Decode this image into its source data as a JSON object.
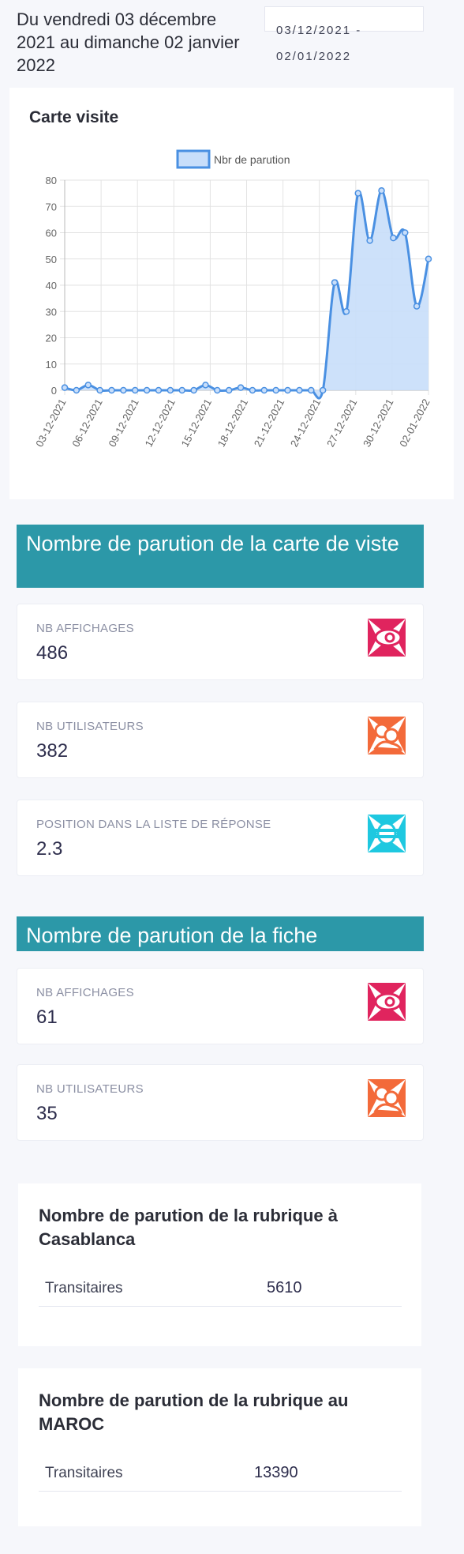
{
  "header": {
    "period_text": "Du vendredi 03 décembre 2021 au dimanche 02 janvier 2022",
    "date_range": "03/12/2021 - 02/01/2022"
  },
  "chart_card": {
    "title": "Carte visite"
  },
  "chart_data": {
    "type": "area",
    "legend_position": "top",
    "grid": true,
    "ylim": [
      0,
      80
    ],
    "y_ticks": [
      0,
      10,
      20,
      30,
      40,
      50,
      60,
      70,
      80
    ],
    "x_tick_labels": [
      "03-12-2021",
      "06-12-2021",
      "09-12-2021",
      "12-12-2021",
      "15-12-2021",
      "18-12-2021",
      "21-12-2021",
      "24-12-2021",
      "27-12-2021",
      "30-12-2021",
      "02-01-2022"
    ],
    "x": [
      "03-12-2021",
      "04-12-2021",
      "05-12-2021",
      "06-12-2021",
      "07-12-2021",
      "08-12-2021",
      "09-12-2021",
      "10-12-2021",
      "11-12-2021",
      "12-12-2021",
      "13-12-2021",
      "14-12-2021",
      "15-12-2021",
      "16-12-2021",
      "17-12-2021",
      "18-12-2021",
      "19-12-2021",
      "20-12-2021",
      "21-12-2021",
      "22-12-2021",
      "23-12-2021",
      "24-12-2021",
      "25-12-2021",
      "26-12-2021",
      "27-12-2021",
      "28-12-2021",
      "29-12-2021",
      "30-12-2021",
      "31-12-2021",
      "01-01-2022",
      "02-01-2022"
    ],
    "series": [
      {
        "name": "Nbr de parution",
        "color": "#4a90e2",
        "fill": "#c8defa",
        "values": [
          1,
          0,
          2,
          0,
          0,
          0,
          0,
          0,
          0,
          0,
          0,
          0,
          2,
          0,
          0,
          1,
          0,
          0,
          0,
          0,
          0,
          0,
          0,
          41,
          30,
          75,
          57,
          76,
          58,
          60,
          32,
          50
        ]
      }
    ]
  },
  "section1": {
    "title": "Nombre de parution de la carte de viste",
    "stats": [
      {
        "label": "NB AFFICHAGES",
        "value": "486",
        "icon": "eye-icon",
        "color": "#e0245e"
      },
      {
        "label": "NB UTILISATEURS",
        "value": "382",
        "icon": "users-icon",
        "color": "#f36a3a"
      },
      {
        "label": "POSITION DANS LA LISTE DE RÉPONSE",
        "value": "2.3",
        "icon": "list-position-icon",
        "color": "#1ec8e0"
      }
    ]
  },
  "section2": {
    "title": "Nombre de parution de la fiche",
    "stats": [
      {
        "label": "NB AFFICHAGES",
        "value": "61",
        "icon": "eye-icon",
        "color": "#e0245e"
      },
      {
        "label": "NB UTILISATEURS",
        "value": "35",
        "icon": "users-icon",
        "color": "#f36a3a"
      }
    ]
  },
  "rubrique_casablanca": {
    "title": "Nombre de parution de la rubrique à Casablanca",
    "rows": [
      {
        "name": "Transitaires",
        "value": "5610"
      }
    ]
  },
  "rubrique_maroc": {
    "title": "Nombre de parution de la rubrique au MAROC",
    "rows": [
      {
        "name": "Transitaires",
        "value": "13390"
      }
    ]
  }
}
